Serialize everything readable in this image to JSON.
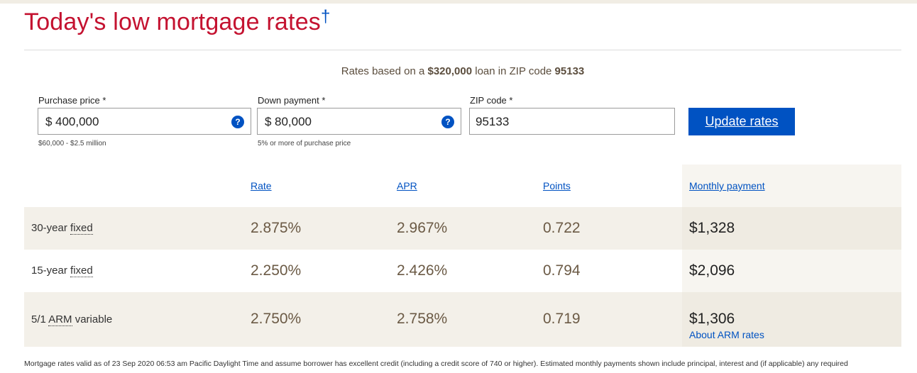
{
  "heading": {
    "title": "Today's low mortgage rates",
    "dagger": "†"
  },
  "basis": {
    "prefix": "Rates based on a ",
    "amount": "$320,000",
    "middle": " loan in ZIP code ",
    "zip": "95133"
  },
  "form": {
    "purchase_price": {
      "label": "Purchase price *",
      "prefix": "$",
      "value": "400,000",
      "hint": "$60,000 - $2.5 million"
    },
    "down_payment": {
      "label": "Down payment *",
      "prefix": "$",
      "value": "80,000",
      "hint": "5% or more of purchase price"
    },
    "zip": {
      "label": "ZIP code *",
      "value": "95133"
    },
    "update_label": "Update rates",
    "help_glyph": "?"
  },
  "table": {
    "headers": {
      "rate": "Rate",
      "apr": "APR",
      "points": "Points",
      "payment": "Monthly payment"
    },
    "rows": [
      {
        "term": "30-year",
        "type": "fixed",
        "rate": "2.875%",
        "apr": "2.967%",
        "points": "0.722",
        "payment": "$1,328"
      },
      {
        "term": "15-year",
        "type": "fixed",
        "rate": "2.250%",
        "apr": "2.426%",
        "points": "0.794",
        "payment": "$2,096"
      },
      {
        "term": "5/1",
        "type_ul": "ARM",
        "type": "variable",
        "rate": "2.750%",
        "apr": "2.758%",
        "points": "0.719",
        "payment": "$1,306"
      }
    ],
    "arm_link": "About ARM rates"
  },
  "footer": "Mortgage rates valid as of 23 Sep 2020 06:53 am Pacific Daylight Time and assume borrower has excellent credit (including a credit score of 740 or higher). Estimated monthly payments shown include principal, interest and (if applicable) any required"
}
